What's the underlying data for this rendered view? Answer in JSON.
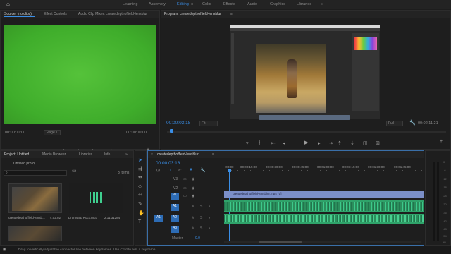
{
  "workspaces": [
    "Learning",
    "Assembly",
    "Editing",
    "Color",
    "Effects",
    "Audio",
    "Graphics",
    "Libraries"
  ],
  "active_workspace": "Editing",
  "source_panel": {
    "tabs": [
      "Source: (no clips)",
      "Effect Controls",
      "Audio Clip Mixer: createdepthoffield-lensblur"
    ],
    "timecode_left": "00:00:00:00",
    "timecode_right": "00:00:00:00",
    "page_label": "Page 1",
    "frame_color": "#47b531"
  },
  "program_panel": {
    "tab": "Program: createdepthoffield-lensblur",
    "timecode": "00:00:03:18",
    "fit": "Fit",
    "full": "Full",
    "duration": "00:02:11:21"
  },
  "project_panel": {
    "tabs": [
      "Project: Untitled",
      "Media Browser",
      "Libraries",
      "Info"
    ],
    "project_file": "Untitled.prproj",
    "items_count": "3 Items",
    "items": [
      {
        "name": "createdepthoffield-lensb...",
        "duration": "4:02:02"
      },
      {
        "name": "Drumstep Rock.mp3",
        "duration": "2:11:31284"
      }
    ]
  },
  "timeline": {
    "tab": "createdepthoffield-lensblur",
    "timecode": "00:00:03:18",
    "ruler": [
      ":00:00",
      "00:00:15:00",
      "00:00:30:00",
      "00:00:45:00",
      "00:01:00:00",
      "00:01:15:00",
      "00:01:30:00",
      "00:01:45:00"
    ],
    "video_tracks": [
      "V3",
      "V2",
      "V1"
    ],
    "audio_tracks": [
      "A1",
      "A2",
      "A3"
    ],
    "master_label": "Master",
    "master_value": "0.0",
    "clip_name": "createdepthoffield-lensblur.mp4 [V]",
    "colors": {
      "video_clip": "#7b8fc8",
      "audio_clip": "#2fa36a",
      "accent": "#3a8ee6"
    }
  },
  "meters": [
    "0",
    "-6",
    "-12",
    "-18",
    "-24",
    "-30",
    "-36",
    "-42",
    "-48",
    "-54",
    "dB"
  ],
  "status_bar": "Drag to vertically adjust the connector line between keyframes. Use Cmd to add a keyframe."
}
